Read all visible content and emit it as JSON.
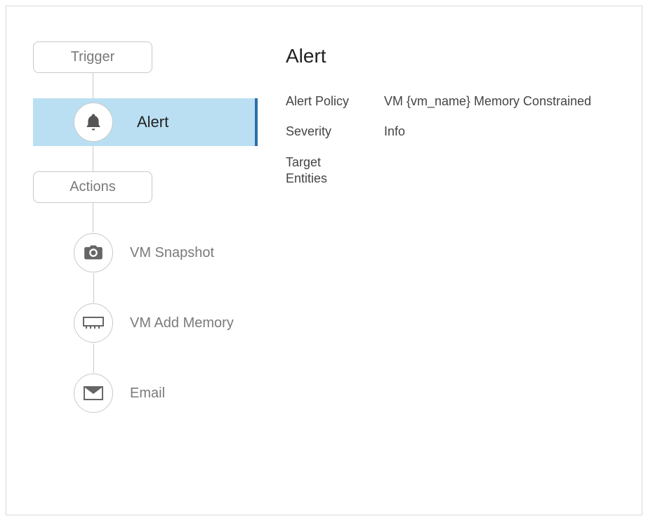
{
  "flow": {
    "trigger_label": "Trigger",
    "alert_label": "Alert",
    "actions_label": "Actions",
    "action_items": [
      {
        "icon": "camera-icon",
        "label": "VM Snapshot"
      },
      {
        "icon": "memory-icon",
        "label": "VM Add Memory"
      },
      {
        "icon": "email-icon",
        "label": "Email"
      }
    ]
  },
  "details": {
    "title": "Alert",
    "rows": [
      {
        "key": "Alert Policy",
        "value": "VM {vm_name} Memory Constrained"
      },
      {
        "key": "Severity",
        "value": "Info"
      }
    ],
    "target_entities_label": "Target\nEntities"
  }
}
